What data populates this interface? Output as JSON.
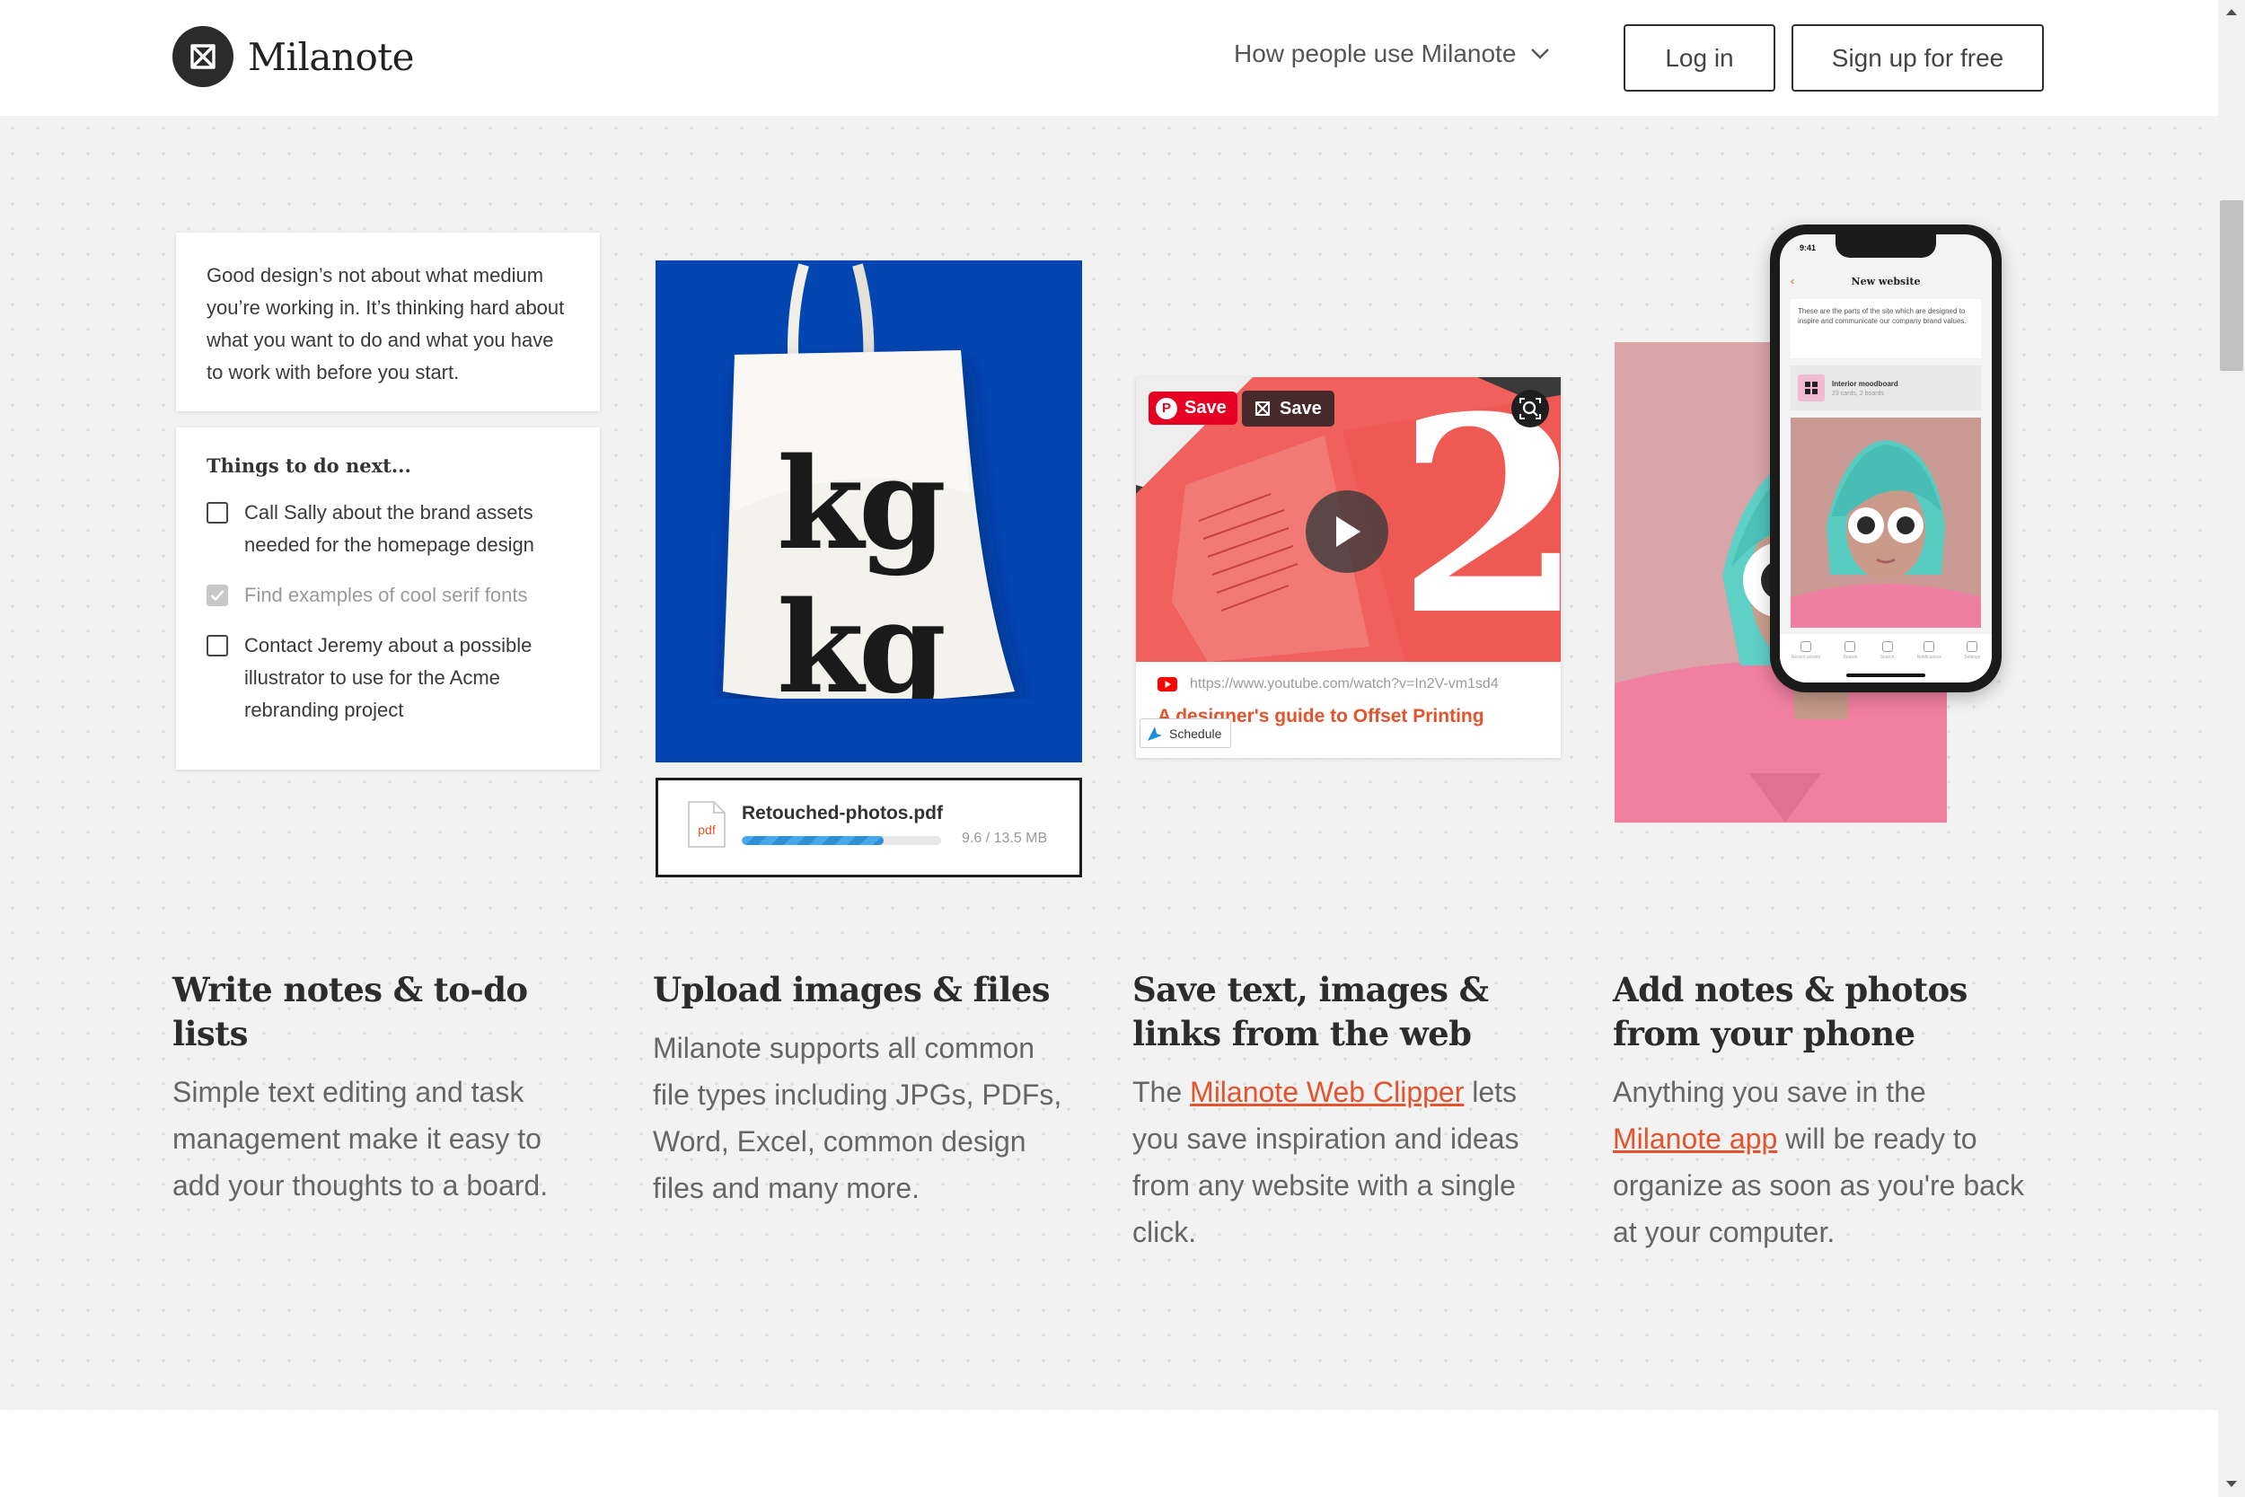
{
  "header": {
    "brand": "Milanote",
    "nav_menu_label": "How people use Milanote",
    "login_label": "Log in",
    "signup_label": "Sign up for free"
  },
  "note_card": {
    "text": "Good design’s not about what medium you’re working in. It’s thinking hard about what you want to do and what you have to work with before you start."
  },
  "todo_card": {
    "title": "Things to do next...",
    "items": [
      {
        "text": "Call Sally about the brand assets needed for the homepage design",
        "done": false
      },
      {
        "text": "Find examples of cool serif fonts",
        "done": true
      },
      {
        "text": "Contact Jeremy about a possible illustrator to use for the Acme rebranding project",
        "done": false
      }
    ]
  },
  "tote": {
    "text_line_1": "kg",
    "text_line_2": "kg"
  },
  "upload": {
    "file_type": "pdf",
    "file_name": "Retouched-photos.pdf",
    "size_text": "9.6 / 13.5 MB",
    "progress": 0.71
  },
  "clipper": {
    "pin_save_label": "Save",
    "milanote_save_label": "Save",
    "video_number": "2",
    "url": "https://www.youtube.com/watch?v=In2V-vm1sd4",
    "title": "A designer's guide to Offset Printing",
    "schedule_label": "Schedule"
  },
  "phone": {
    "time": "9:41",
    "screen_title": "New website",
    "note_text": "These are the parts of the site which are designed to inspire and communicate our company brand values.",
    "board_title": "Interior moodboard",
    "board_meta": "23 cards, 2 boards",
    "tabs": [
      "Recent activity",
      "Boards",
      "Search",
      "Notifications",
      "Settings"
    ]
  },
  "features": [
    {
      "heading": "Write notes & to-do lists",
      "text": "Simple text editing and task management make it easy to add your thoughts to a board."
    },
    {
      "heading": "Upload images & files",
      "text": "Milanote supports all common file types including JPGs, PDFs, Word, Excel, common design files and many more."
    },
    {
      "heading": "Save text, images & links from the web",
      "text_before": "The ",
      "link": "Milanote Web Clipper",
      "text_after": " lets you save inspiration and ideas from any website with a single click."
    },
    {
      "heading": "Add notes & photos from your phone",
      "text_before": "Anything you save in the ",
      "link": "Milanote app",
      "text_after": " will be ready to organize as soon as you're back at your computer."
    }
  ],
  "colors": {
    "accent": "#e3532c",
    "tote_blue": "#0346b2",
    "canvas": "#f2f2f2"
  }
}
